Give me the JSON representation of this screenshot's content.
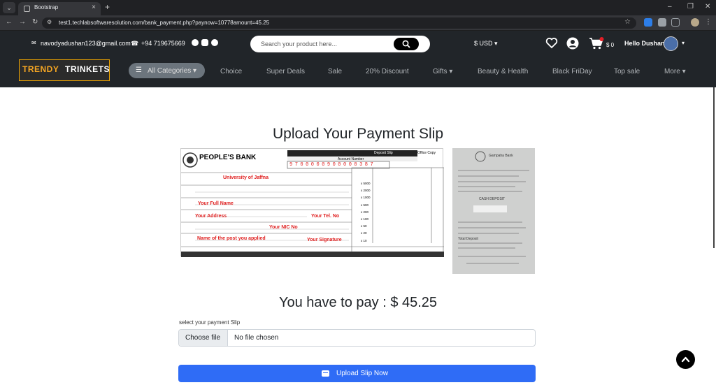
{
  "browser": {
    "tab_title": "Bootstrap",
    "url": "test1.techlabsoftwaresolution.com/bank_payment.php?paynow=10778amount=45.25"
  },
  "topbar": {
    "email": "navodyadushan123@gmail.com",
    "phone": "+94 719675669",
    "search_placeholder": "Search your product here...",
    "currency": "$ USD",
    "cart_amount": "$ 0",
    "greeting": "Hello Dushan"
  },
  "logo": {
    "part1": "TRENDY",
    "part2": "TRINKETS"
  },
  "nav": {
    "categories": "All Categories",
    "links": [
      "Choice",
      "Super Deals",
      "Sale",
      "20% Discount",
      "Gifts",
      "Beauty & Health",
      "Black FriDay",
      "Top sale",
      "More"
    ]
  },
  "main": {
    "title": "Upload Your Payment Slip",
    "amount_text": "You have to pay : $ 45.25",
    "file_label": "select your payment Slip",
    "file_button": "Choose file",
    "file_status": "No file chosen",
    "upload_button": "Upload Slip Now"
  },
  "slip": {
    "bank_name": "PEOPLE'S BANK",
    "slip_type": "Deposit Slip",
    "copy_label": "Office Copy",
    "account_label": "Account Number",
    "account_number": "9700000900000387",
    "account_holder": "University of Jaffna",
    "full_name": "Your Full Name",
    "address": "Your Address",
    "tel": "Your Tel. No",
    "nic": "Your NIC No",
    "purpose": "Name of the post you applied",
    "signature": "Your Signature",
    "denominations": [
      "x 5000",
      "x 2000",
      "x 1000",
      "x 500",
      "x 200",
      "x 100",
      "x 50",
      "x 20",
      "x 10"
    ]
  },
  "receipt": {
    "bank_name": "Gampaha Bank",
    "deposit_label": "CASH DEPOSIT",
    "total_label": "Total Deposit"
  }
}
